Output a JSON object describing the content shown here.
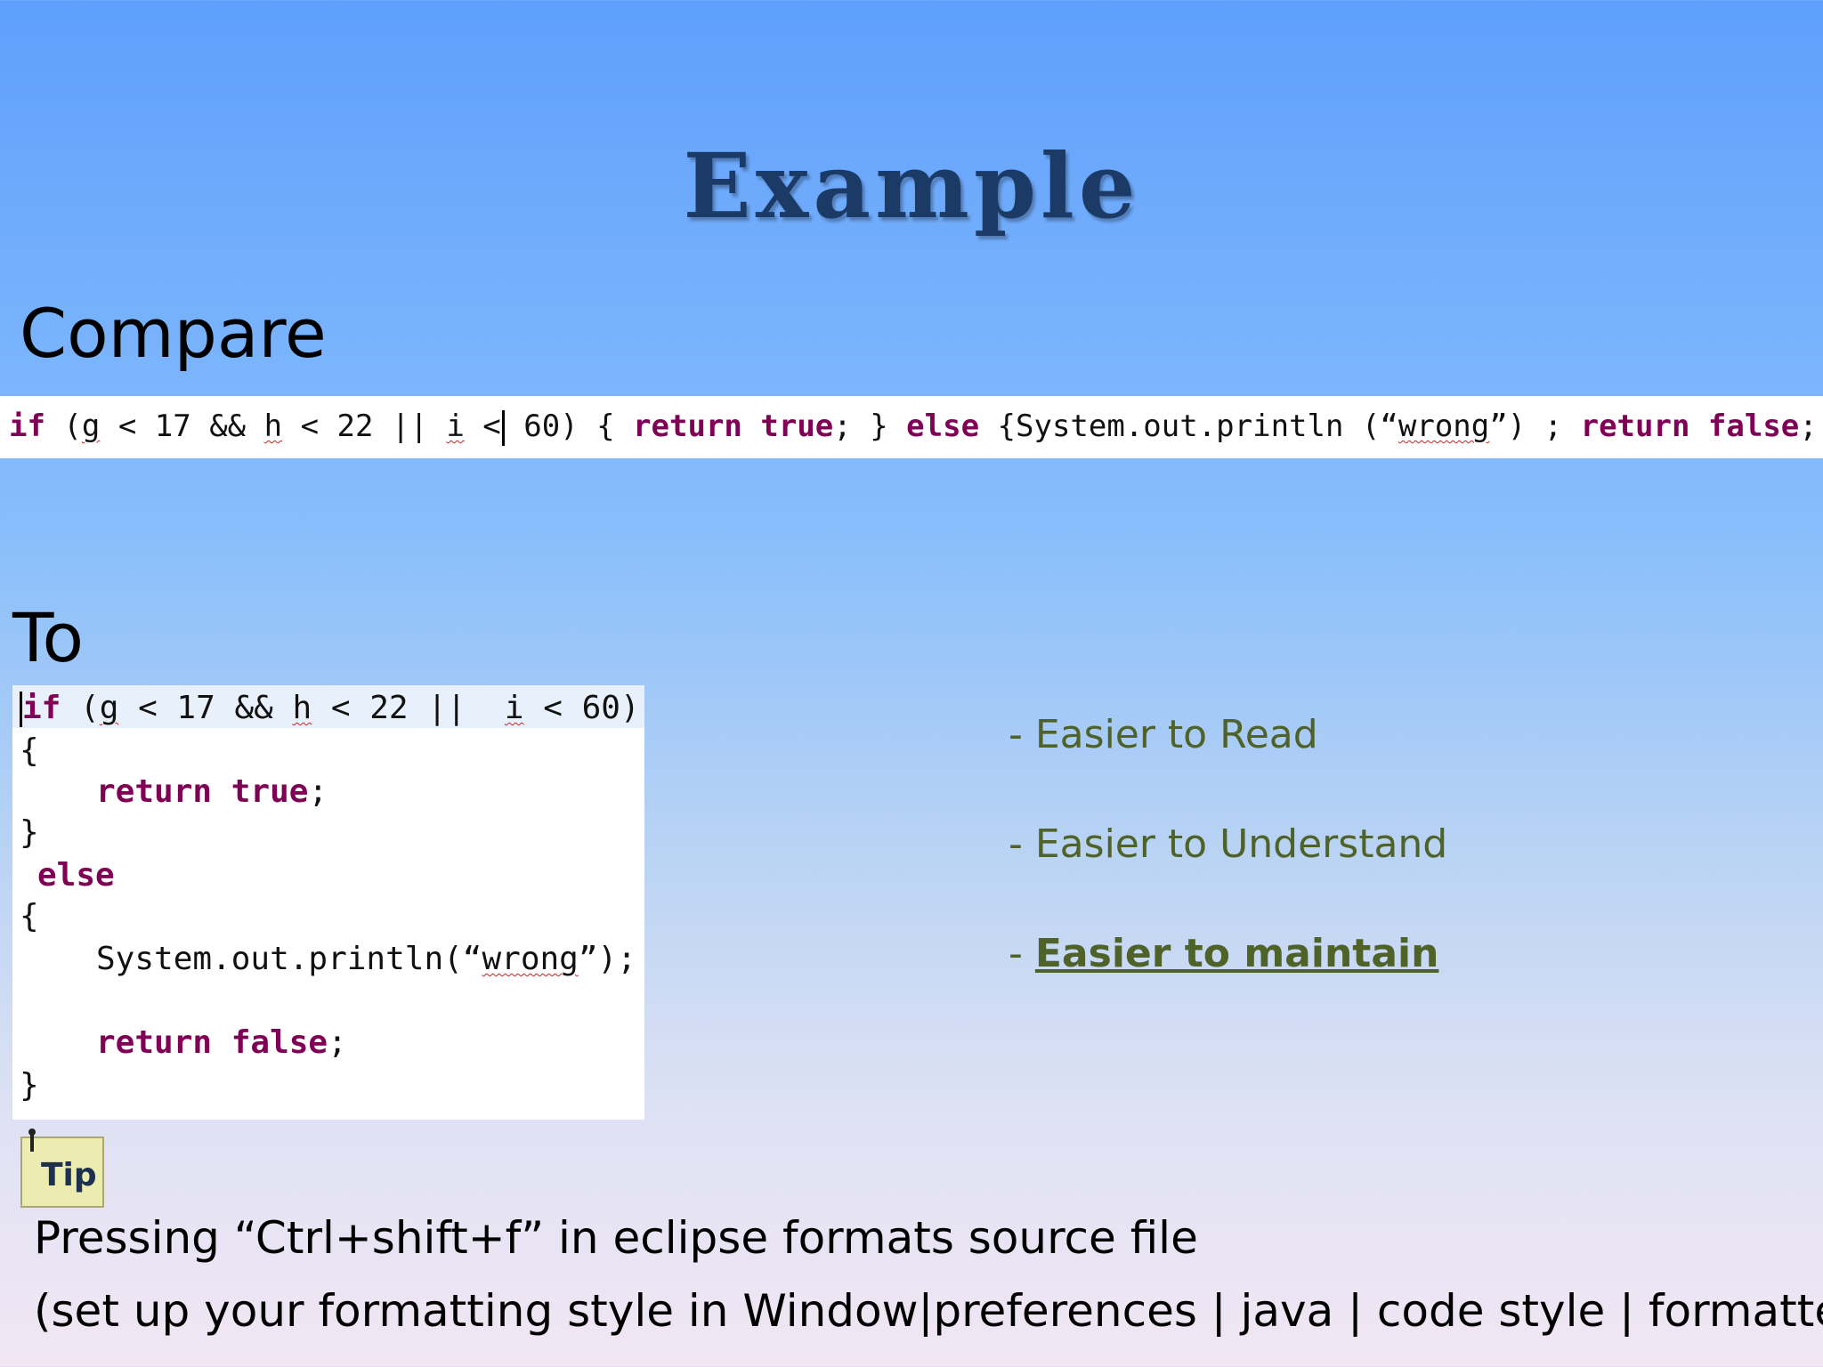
{
  "slide": {
    "title": "Example",
    "compare_label": "Compare",
    "to_label": "To"
  },
  "compact_code": {
    "p1": "if",
    "p2": " (",
    "p3": "g",
    "p4": " < 17 && ",
    "p5": "h",
    "p6": " < 22 || ",
    "p7": "i",
    "p8": " <",
    "p9": " 60) { ",
    "p10": "return",
    "p11": " ",
    "p12": "true",
    "p13": "; } ",
    "p14": "else",
    "p15": " {System.out.println (“",
    "p16": "wrong",
    "p17": "”) ; ",
    "p18": "return",
    "p19": " ",
    "p20": "false",
    "p21": "; }"
  },
  "formatted_code": {
    "l1a": "if",
    "l1b": " (",
    "l1c": "g",
    "l1d": " < 17 && ",
    "l1e": "h",
    "l1f": " < 22 ||  ",
    "l1g": "i",
    "l1h": " < 60)",
    "l2": "{",
    "l3a": "return",
    "l3b": " ",
    "l3c": "true",
    "l3d": ";",
    "l4": "}",
    "l5": "else",
    "l6": "{",
    "l7a": "System.out.println(“",
    "l7b": "wrong",
    "l7c": "”);",
    "l8a": "return",
    "l8b": " ",
    "l8c": "false",
    "l8d": ";",
    "l9": "}"
  },
  "benefits": [
    {
      "dash": "- ",
      "text": "Easier to Read"
    },
    {
      "dash": "- ",
      "text": "Easier to Understand"
    },
    {
      "dash": "- ",
      "text": "Easier to maintain"
    }
  ],
  "tip": {
    "icon_label": "Tip",
    "line1": "Pressing “Ctrl+shift+f” in eclipse formats source file",
    "line2": "(set up your formatting style in Window|preferences | java | code style | formatter)"
  },
  "colors": {
    "keyword": "#7f0055",
    "benefit_text": "#4f6228",
    "title": "#1c3a66"
  }
}
